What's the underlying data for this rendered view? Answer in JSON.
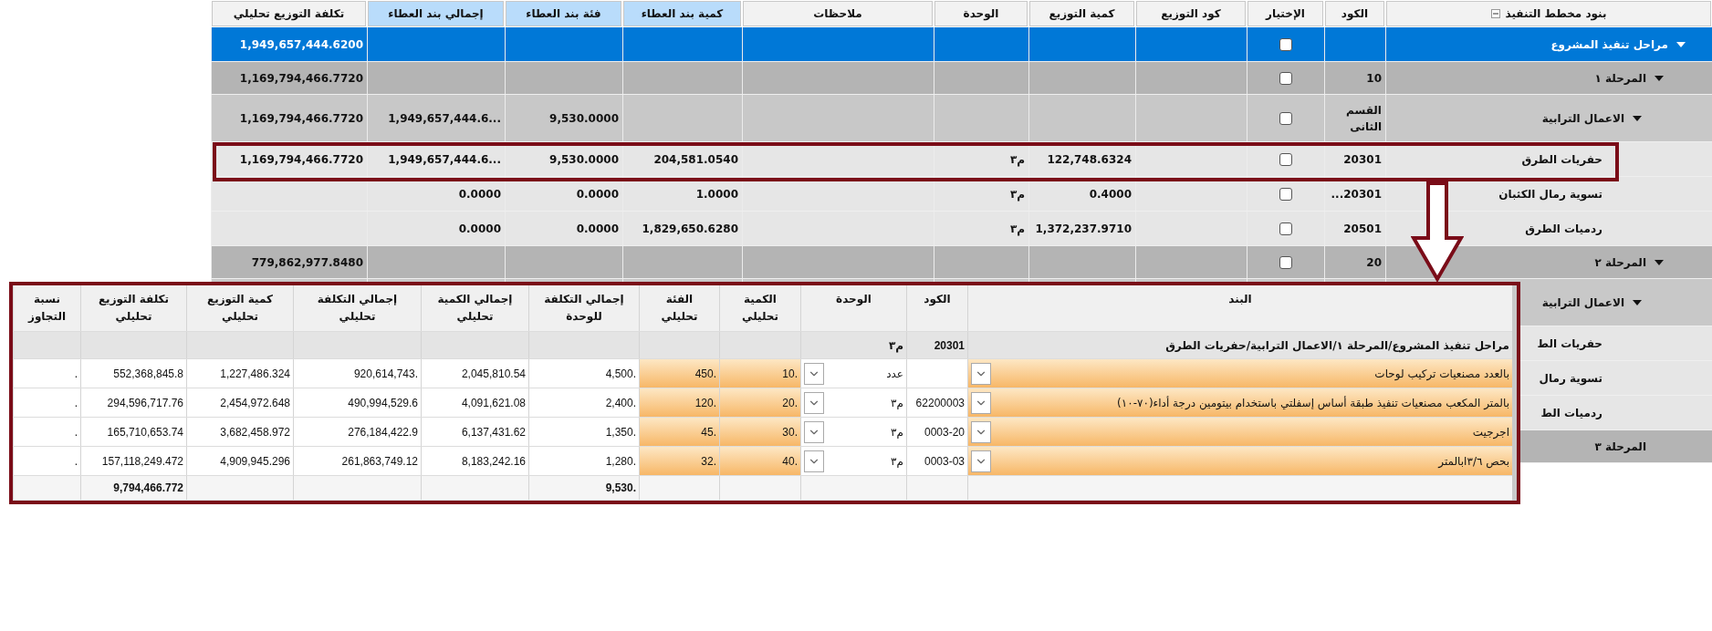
{
  "plan_grid": {
    "columns": [
      {
        "label": "بنود مخطط التنفيذ",
        "highlighted": false
      },
      {
        "label": "الكود",
        "highlighted": false
      },
      {
        "label": "الإختيار",
        "highlighted": false
      },
      {
        "label": "كود التوزيع",
        "highlighted": false
      },
      {
        "label": "كمية التوزيع",
        "highlighted": false
      },
      {
        "label": "الوحدة",
        "highlighted": false
      },
      {
        "label": "ملاحظات",
        "highlighted": false
      },
      {
        "label": "كمية بند العطاء",
        "highlighted": true
      },
      {
        "label": "فئة بند العطاء",
        "highlighted": true
      },
      {
        "label": "إجمالي بند العطاء",
        "highlighted": true
      },
      {
        "label": "تكلفة التوزيع تحليلي",
        "highlighted": false
      }
    ],
    "rows": [
      {
        "selected": true,
        "expanded": true,
        "checked": false,
        "cells": [
          "مراحل تنفيذ المشروع",
          "",
          "",
          "",
          "",
          "",
          "",
          "",
          "",
          "",
          "1,949,657,444.6200"
        ],
        "children": [
          {
            "selected": false,
            "expanded": true,
            "checked": false,
            "cells": [
              "المرحلة ١",
              "10",
              "",
              "",
              "",
              "",
              "",
              "",
              "",
              "",
              "1,169,794,466.7720"
            ],
            "children": [
              {
                "selected": false,
                "expanded": true,
                "checked": false,
                "cells": [
                  "الاعمال الترابية",
                  "القسم الثانى",
                  "",
                  "",
                  "",
                  "",
                  "",
                  "",
                  "9,530.0000",
                  "1,949,657,444.6...",
                  "1,169,794,466.7720"
                ],
                "children": [
                  {
                    "selected": false,
                    "checked": false,
                    "cells": [
                      "حفريات الطرق",
                      "20301",
                      "",
                      "",
                      "122,748.6324",
                      "م٣",
                      "",
                      "204,581.0540",
                      "9,530.0000",
                      "1,949,657,444.6...",
                      "1,169,794,466.7720"
                    ]
                  },
                  {
                    "selected": false,
                    "checked": false,
                    "cells": [
                      "تسوية رمال الكثبان",
                      "20301...",
                      "",
                      "",
                      "0.4000",
                      "م٣",
                      "",
                      "1.0000",
                      "0.0000",
                      "0.0000",
                      ""
                    ]
                  },
                  {
                    "selected": false,
                    "checked": false,
                    "cells": [
                      "ردميات الطرق",
                      "20501",
                      "",
                      "",
                      "1,372,237.9710",
                      "م٣",
                      "",
                      "1,829,650.6280",
                      "0.0000",
                      "0.0000",
                      ""
                    ]
                  }
                ]
              }
            ]
          },
          {
            "selected": false,
            "expanded": true,
            "checked": false,
            "cells": [
              "المرحلة ٢",
              "20",
              "",
              "",
              "",
              "",
              "",
              "",
              "",
              "",
              "779,862,977.8480"
            ],
            "children": [
              {
                "selected": false,
                "expanded": true,
                "cells": [
                  "الاعمال الترابية"
                ],
                "children": [
                  {
                    "selected": false,
                    "cells": [
                      "حفريات الط"
                    ]
                  },
                  {
                    "selected": false,
                    "cells": [
                      "تسوية رمال"
                    ]
                  },
                  {
                    "selected": false,
                    "cells": [
                      "ردميات الط"
                    ]
                  }
                ]
              }
            ]
          },
          {
            "selected": false,
            "cells": [
              "المرحلة ٣"
            ]
          }
        ]
      }
    ]
  },
  "detail_grid": {
    "columns": [
      "البند",
      "الكود",
      "الوحدة",
      "الكمية تحليلي",
      "الفئة تحليلي",
      "إجمالي التكلفة للوحدة",
      "إجمالي الكمية تحليلي",
      "إجمالي التكلفة تحليلي",
      "كمية التوزيع تحليلي",
      "تكلفة التوزيع تحليلي",
      "نسبة التجاوز"
    ],
    "rows": [
      {
        "kind": "group",
        "cells": [
          "مراحل تنفيذ المشروع/المرحلة ١/الاعمال الترابية/حفريات الطرق",
          "20301",
          "م٣"
        ]
      },
      {
        "kind": "item",
        "cells": [
          "بالعدد مصنعيات تركيب لوحات",
          "",
          "عدد",
          "10.",
          "450.",
          "4,500.",
          "2,045,810.54",
          "920,614,743.",
          "1,227,486.324",
          "552,368,845.8",
          "."
        ]
      },
      {
        "kind": "item",
        "cells": [
          "بالمتر المكعب مصنعيات تنفيذ طبقة أساس إسفلتي باستخدام بيتومين درجة أداء(٧٠-١٠)",
          "62200003",
          "م٣",
          "20.",
          "120.",
          "2,400.",
          "4,091,621.08",
          "490,994,529.6",
          "2,454,972.648",
          "294,596,717.76",
          "."
        ]
      },
      {
        "kind": "item",
        "cells": [
          "اجرجيت",
          "0003-20",
          "م٣",
          "30.",
          "45.",
          "1,350.",
          "6,137,431.62",
          "276,184,422.9",
          "3,682,458.972",
          "165,710,653.74",
          "."
        ]
      },
      {
        "kind": "item",
        "cells": [
          "بحص ٣/٦ابالمتر",
          "0003-03",
          "م٣",
          "40.",
          "32.",
          "1,280.",
          "8,183,242.16",
          "261,863,749.12",
          "4,909,945.296",
          "157,118,249.472",
          "."
        ]
      },
      {
        "kind": "total",
        "cells": [
          "",
          "",
          "",
          "",
          "",
          "9,530.",
          "",
          "",
          "",
          "9,794,466.772"
        ]
      }
    ]
  }
}
